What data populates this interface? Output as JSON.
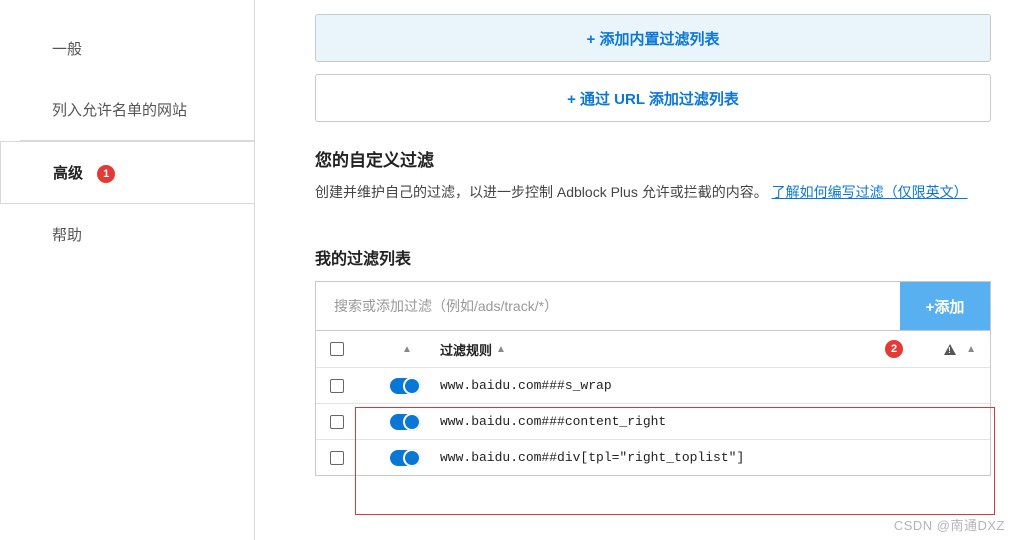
{
  "sidebar": {
    "items": [
      {
        "label": "一般"
      },
      {
        "label": "列入允许名单的网站"
      },
      {
        "label": "高级",
        "badge": "1"
      },
      {
        "label": "帮助"
      }
    ]
  },
  "buttons": {
    "add_builtin": "+ 添加内置过滤列表",
    "add_by_url": "+ 通过 URL 添加过滤列表",
    "add": "+添加"
  },
  "custom_section": {
    "title": "您的自定义过滤",
    "desc_pre": "创建并维护自己的过滤，以进一步控制 Adblock Plus 允许或拦截的内容。",
    "link": "了解如何编写过滤（仅限英文）"
  },
  "my_list": {
    "title": "我的过滤列表",
    "placeholder": "搜索或添加过滤（例如/ads/track/*）",
    "input_badge": "2",
    "header_rule": "过滤规则",
    "rows": [
      {
        "rule": "www.baidu.com###s_wrap"
      },
      {
        "rule": "www.baidu.com###content_right"
      },
      {
        "rule": "www.baidu.com##div[tpl=\"right_toplist\"]"
      }
    ]
  },
  "watermark": "CSDN @南通DXZ"
}
